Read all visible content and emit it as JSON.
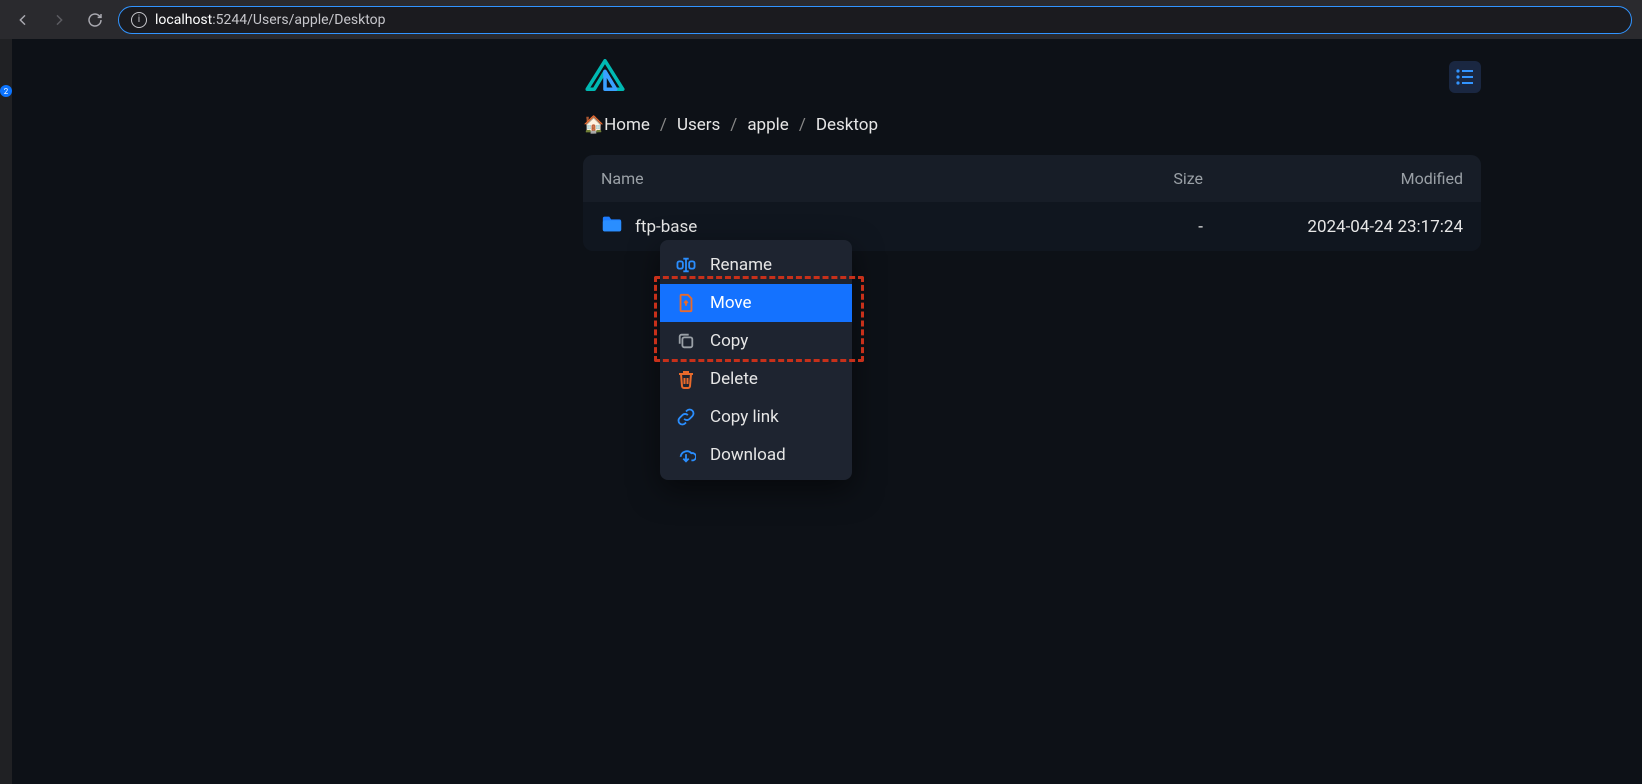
{
  "browser": {
    "url_host": "localhost",
    "url_rest": ":5244/Users/apple/Desktop"
  },
  "rail_badge": "2",
  "breadcrumbs": [
    "🏠Home",
    "Users",
    "apple",
    "Desktop"
  ],
  "columns": {
    "name": "Name",
    "size": "Size",
    "modified": "Modified"
  },
  "rows": [
    {
      "name": "ftp-base",
      "size": "-",
      "modified": "2024-04-24 23:17:24"
    }
  ],
  "context_menu": {
    "items": [
      {
        "label": "Rename",
        "icon": "rename",
        "highlighted": false
      },
      {
        "label": "Move",
        "icon": "move",
        "highlighted": true
      },
      {
        "label": "Copy",
        "icon": "copy",
        "highlighted": false
      },
      {
        "label": "Delete",
        "icon": "delete",
        "highlighted": false
      },
      {
        "label": "Copy link",
        "icon": "link",
        "highlighted": false
      },
      {
        "label": "Download",
        "icon": "download",
        "highlighted": false
      }
    ]
  }
}
